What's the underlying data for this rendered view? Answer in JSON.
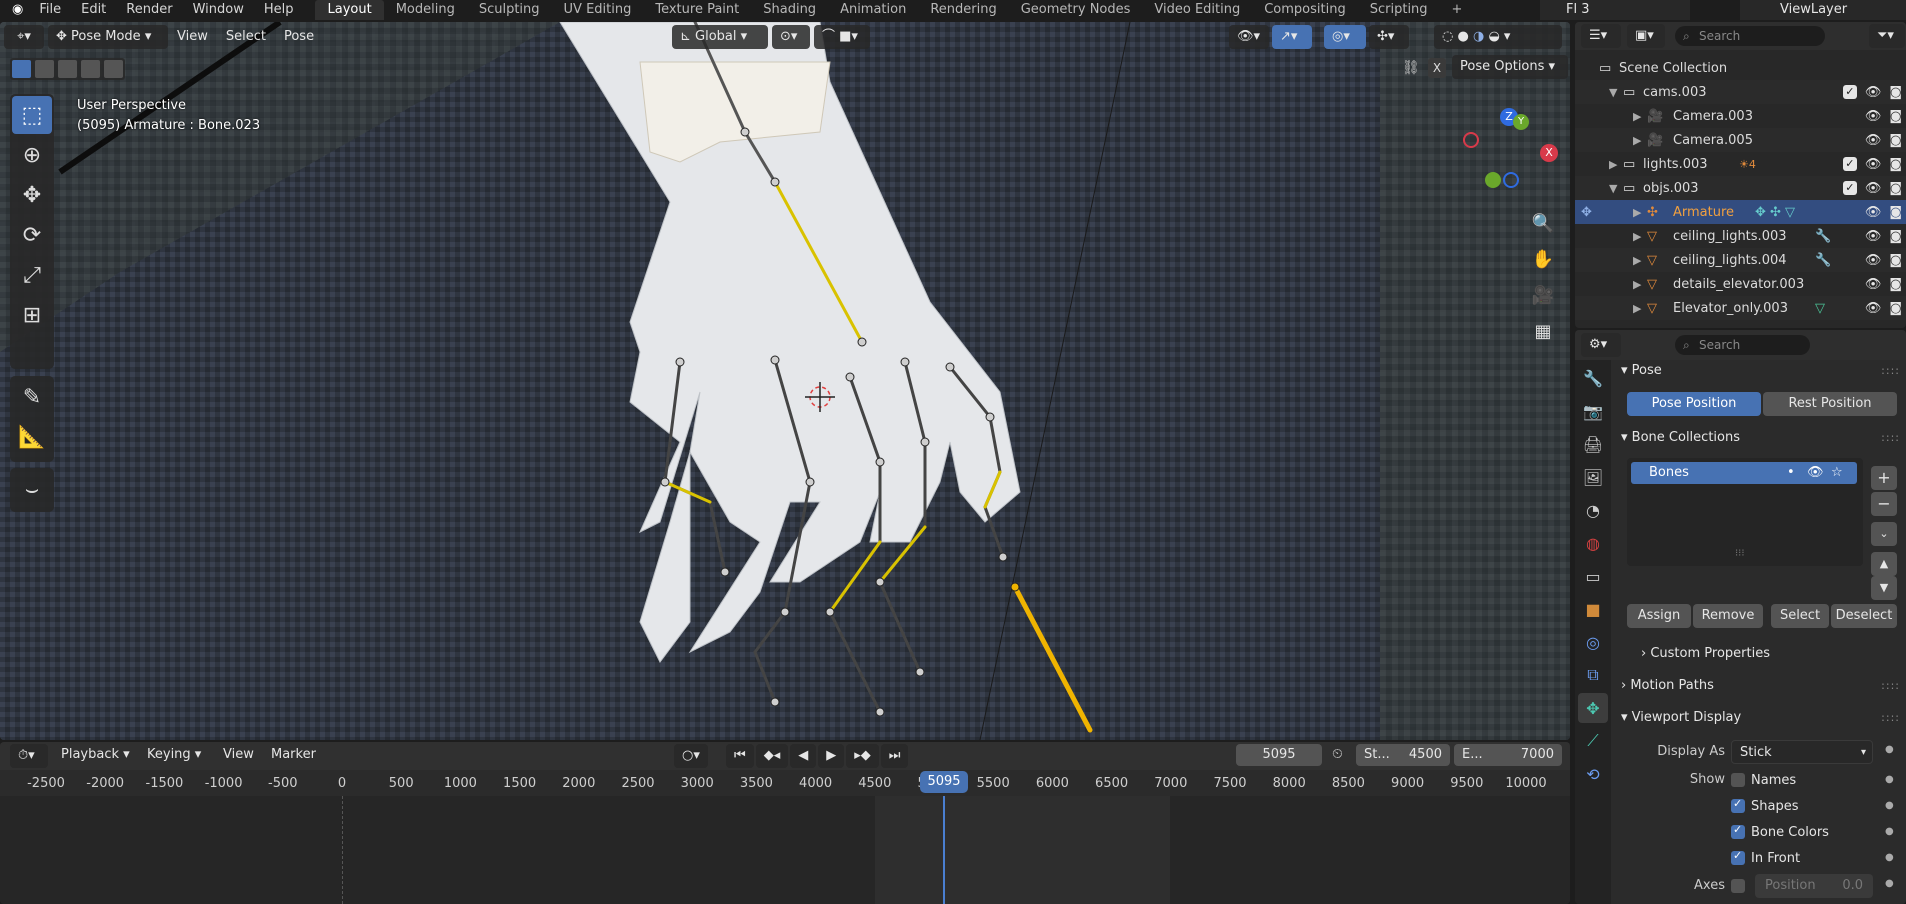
{
  "topbar": {
    "menus": [
      "File",
      "Edit",
      "Render",
      "Window",
      "Help"
    ],
    "workspaces": [
      "Layout",
      "Modeling",
      "Sculpting",
      "UV Editing",
      "Texture Paint",
      "Shading",
      "Animation",
      "Rendering",
      "Geometry Nodes",
      "Video Editing",
      "Compositing",
      "Scripting"
    ],
    "active_workspace": "Layout",
    "add_workspace": "+",
    "scene_name": "Fl 3",
    "view_layer": "ViewLayer"
  },
  "viewport": {
    "mode": "Pose Mode",
    "menus": [
      "View",
      "Select",
      "Pose"
    ],
    "orientation": "Global",
    "perspective_label": "User Perspective",
    "active_info": "(5095) Armature : Bone.023",
    "pose_options": "Pose Options",
    "close_x": "X",
    "gizmo": {
      "z": "Z",
      "y": "Y",
      "x": "X"
    }
  },
  "timeline": {
    "menus": [
      "Playback",
      "Keying",
      "View",
      "Marker"
    ],
    "current_frame": "5095",
    "start_label": "St...",
    "start": "4500",
    "end_label": "E...",
    "end": "7000",
    "ticks": [
      "-2500",
      "-2000",
      "-1500",
      "-1000",
      "-500",
      "0",
      "500",
      "1000",
      "1500",
      "2000",
      "2500",
      "3000",
      "3500",
      "4000",
      "4500",
      "5000",
      "5500",
      "6000",
      "6500",
      "7000",
      "7500",
      "8000",
      "8500",
      "9000",
      "9500",
      "10000"
    ],
    "playhead": "5095"
  },
  "outliner": {
    "search_placeholder": "Search",
    "rows": [
      {
        "label": "Scene Collection",
        "indent": 0
      },
      {
        "label": "cams.003",
        "indent": 1
      },
      {
        "label": "Camera.003",
        "indent": 2
      },
      {
        "label": "Camera.005",
        "indent": 2
      },
      {
        "label": "lights.003",
        "indent": 1,
        "badge": "4"
      },
      {
        "label": "objs.003",
        "indent": 1
      },
      {
        "label": "Armature",
        "indent": 2,
        "selected": true
      },
      {
        "label": "ceiling_lights.003",
        "indent": 2
      },
      {
        "label": "ceiling_lights.004",
        "indent": 2
      },
      {
        "label": "details_elevator.003",
        "indent": 2
      },
      {
        "label": "Elevator_only.003",
        "indent": 2
      }
    ]
  },
  "properties": {
    "search_placeholder": "Search",
    "pose_panel": "Pose",
    "pose_position": "Pose Position",
    "rest_position": "Rest Position",
    "bone_collections": "Bone Collections",
    "collection_item": "Bones",
    "assign": "Assign",
    "remove": "Remove",
    "select": "Select",
    "deselect": "Deselect",
    "custom_properties": "Custom Properties",
    "motion_paths": "Motion Paths",
    "viewport_display": "Viewport Display",
    "display_as_label": "Display As",
    "display_as_value": "Stick",
    "show_label": "Show",
    "show_names": "Names",
    "show_shapes": "Shapes",
    "show_bone_colors": "Bone Colors",
    "show_in_front": "In Front",
    "axes_label": "Axes",
    "position_label": "Position",
    "position_value": "0.0"
  },
  "colors": {
    "accent_blue": "#4772b3",
    "selected_bone": "#f0b400",
    "object_orange": "#e08a3c"
  }
}
